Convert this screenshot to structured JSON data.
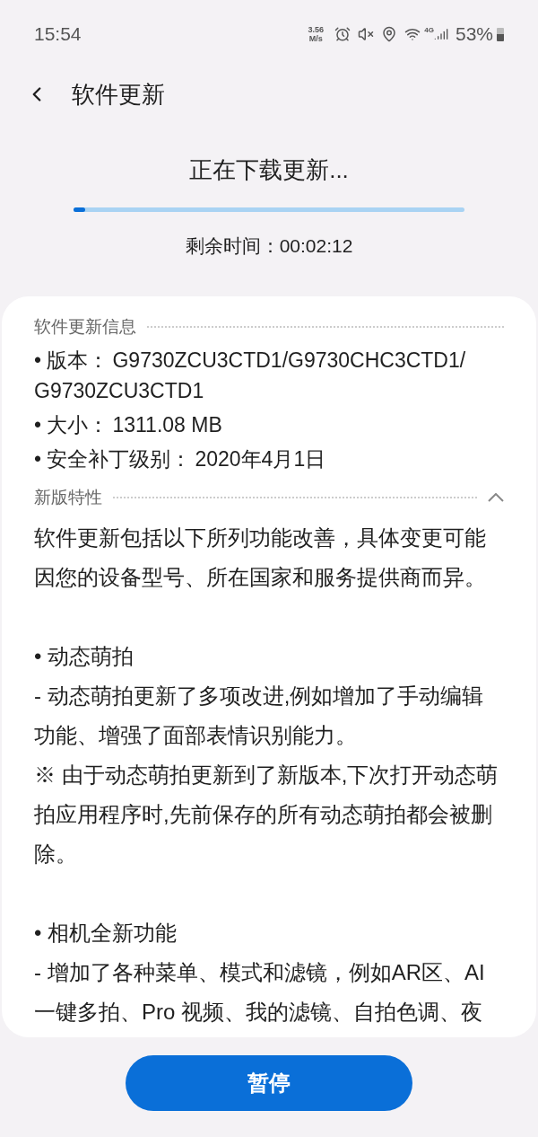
{
  "status_bar": {
    "time": "15:54",
    "speed": "3.56 M/s",
    "network": "4G",
    "battery": "53%"
  },
  "header": {
    "title": "软件更新"
  },
  "download": {
    "status": "正在下载更新...",
    "level": 0.03,
    "remaining": "剩余时间：00:02:12"
  },
  "info": {
    "title": "软件更新信息",
    "items": [
      {
        "label": "• 版本：",
        "value": "G9730ZCU3CTD1/G9730CHC3CTD1/ G9730ZCU3CTD1"
      },
      {
        "label": "• 大小：",
        "value": "1311.08 MB"
      },
      {
        "label": "• 安全补丁级别：",
        "value": "2020年4月1日"
      }
    ]
  },
  "features": {
    "title": "新版特性",
    "expanded": true,
    "blocks": [
      {
        "kind": "paragraph",
        "text": "软件更新包括以下所列功能改善，具体变更可能因您的设备型号、所在国家和服务提供商而异。"
      },
      {
        "kind": "heading",
        "text": "• 动态萌拍"
      },
      {
        "kind": "paragraph",
        "text": "- 动态萌拍更新了多项改进,例如增加了手动编辑功能、增强了面部表情识别能力。"
      },
      {
        "kind": "paragraph",
        "text": "※ 由于动态萌拍更新到了新版本,下次打开动态萌拍应用程序时,先前保存的所有动态萌拍都会被删除。"
      },
      {
        "kind": "heading",
        "text": "• 相机全新功能"
      },
      {
        "kind": "paragraph",
        "text": "- 增加了各种菜单、模式和滤镜，例如AR区、AI一键多拍、Pro 视频、我的滤镜、自拍色调、夜"
      }
    ]
  },
  "pause_button": "暂停"
}
